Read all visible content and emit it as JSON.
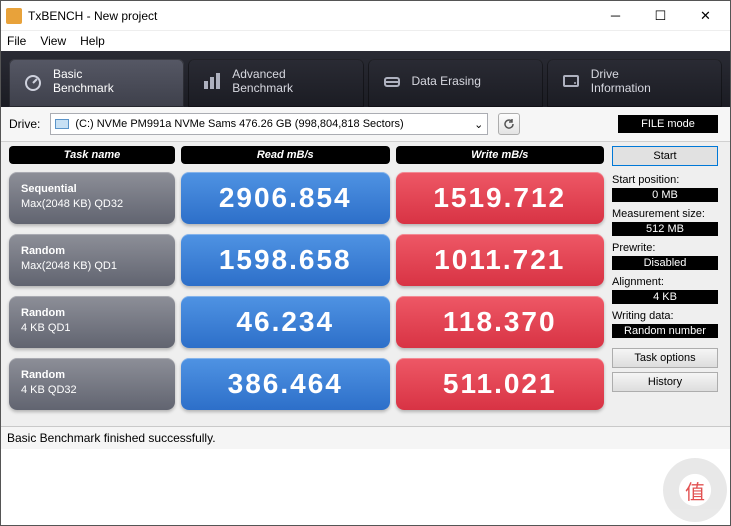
{
  "window": {
    "title": "TxBENCH - New project"
  },
  "menu": [
    "File",
    "View",
    "Help"
  ],
  "tabs": [
    {
      "line1": "Basic",
      "line2": "Benchmark"
    },
    {
      "line1": "Advanced",
      "line2": "Benchmark"
    },
    {
      "line1": "Data Erasing",
      "line2": ""
    },
    {
      "line1": "Drive",
      "line2": "Information"
    }
  ],
  "drive": {
    "label": "Drive:",
    "selected": "(C:) NVMe PM991a NVMe Sams  476.26 GB (998,804,818 Sectors)",
    "filemode": "FILE mode"
  },
  "headers": {
    "task": "Task name",
    "read": "Read mB/s",
    "write": "Write mB/s"
  },
  "rows": [
    {
      "t1": "Sequential",
      "t2": "Max(2048 KB) QD32",
      "read": "2906.854",
      "write": "1519.712"
    },
    {
      "t1": "Random",
      "t2": "Max(2048 KB) QD1",
      "read": "1598.658",
      "write": "1011.721"
    },
    {
      "t1": "Random",
      "t2": "4 KB QD1",
      "read": "46.234",
      "write": "118.370"
    },
    {
      "t1": "Random",
      "t2": "4 KB QD32",
      "read": "386.464",
      "write": "511.021"
    }
  ],
  "side": {
    "start": "Start",
    "startpos_l": "Start position:",
    "startpos_v": "0 MB",
    "msize_l": "Measurement size:",
    "msize_v": "512 MB",
    "prewrite_l": "Prewrite:",
    "prewrite_v": "Disabled",
    "align_l": "Alignment:",
    "align_v": "4 KB",
    "wdata_l": "Writing data:",
    "wdata_v": "Random number",
    "taskopt": "Task options",
    "history": "History"
  },
  "status": "Basic Benchmark finished successfully."
}
